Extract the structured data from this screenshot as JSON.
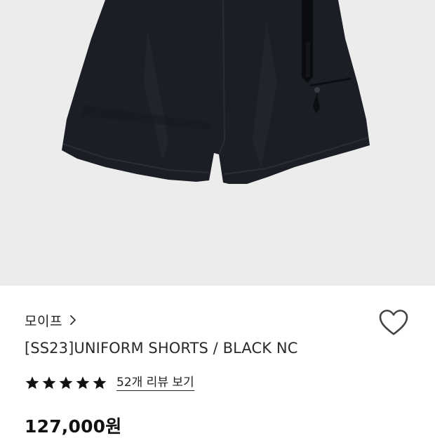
{
  "product": {
    "image_alt": "black uniform shorts",
    "brand": "모이프",
    "title": "[SS23]UNIFORM SHORTS / BLACK NC",
    "rating": 5,
    "rating_max": 5,
    "review_link": "52개 리뷰 보기",
    "price": "127,000원"
  },
  "icons": {
    "brand_chevron": "chevron-right-icon",
    "wishlist": "heart-outline-icon",
    "star": "star-filled-icon"
  },
  "colors": {
    "image_background": "#ececec",
    "shorts": "#1c1e26",
    "text": "#1a1a1a"
  }
}
